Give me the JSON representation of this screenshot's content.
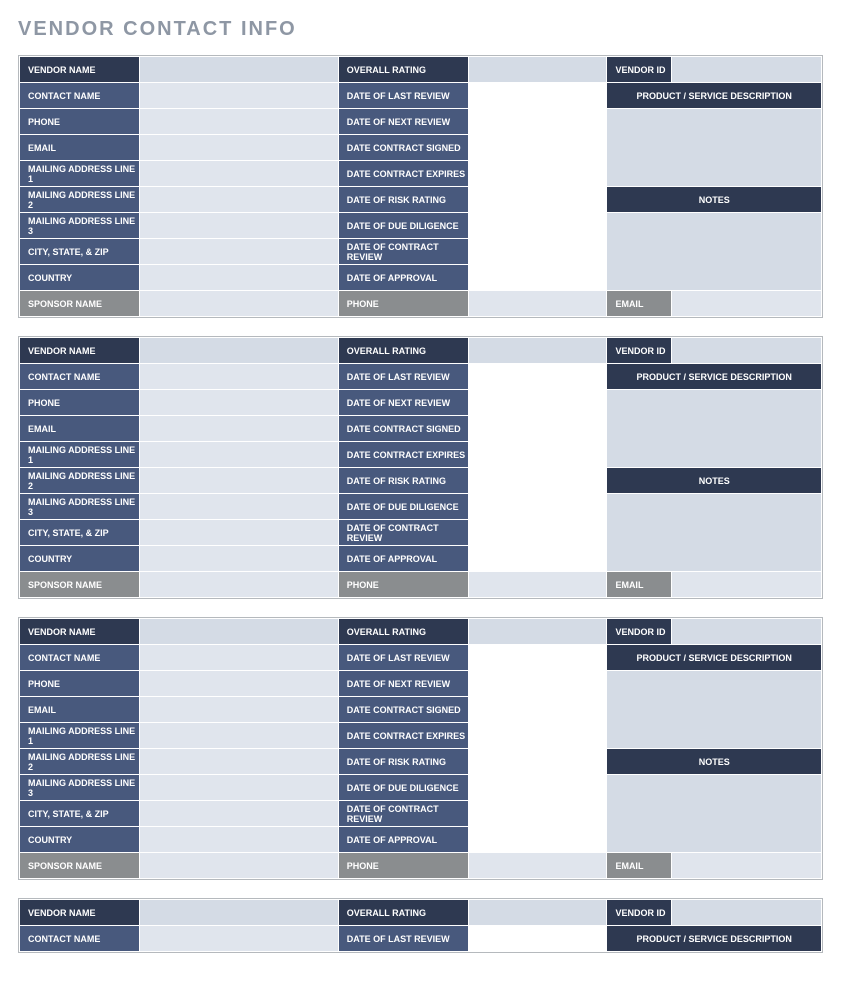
{
  "title": "VENDOR CONTACT INFO",
  "labels": {
    "vendor_name": "VENDOR NAME",
    "overall_rating": "OVERALL RATING",
    "vendor_id": "VENDOR ID",
    "contact_name": "CONTACT NAME",
    "date_last_review": "DATE OF LAST REVIEW",
    "product_service_desc": "PRODUCT / SERVICE DESCRIPTION",
    "phone": "PHONE",
    "date_next_review": "DATE OF NEXT REVIEW",
    "email": "EMAIL",
    "date_contract_signed": "DATE CONTRACT SIGNED",
    "mailing_1": "MAILING ADDRESS LINE 1",
    "date_contract_expires": "DATE CONTRACT EXPIRES",
    "mailing_2": "MAILING ADDRESS LINE 2",
    "date_risk_rating": "DATE OF RISK RATING",
    "notes": "NOTES",
    "mailing_3": "MAILING ADDRESS LINE 3",
    "date_due_diligence": "DATE OF DUE DILIGENCE",
    "city_state_zip": "CITY, STATE, & ZIP",
    "date_contract_review": "DATE OF CONTRACT REVIEW",
    "country": "COUNTRY",
    "date_approval": "DATE OF APPROVAL",
    "sponsor_name": "SPONSOR NAME",
    "sponsor_phone": "PHONE",
    "sponsor_email": "EMAIL"
  },
  "vendors": [
    {
      "vendor_name": "",
      "overall_rating": "",
      "vendor_id": "",
      "contact_name": "",
      "date_last_review": "",
      "phone": "",
      "date_next_review": "",
      "email": "",
      "date_contract_signed": "",
      "mailing_1": "",
      "date_contract_expires": "",
      "mailing_2": "",
      "date_risk_rating": "",
      "mailing_3": "",
      "date_due_diligence": "",
      "city_state_zip": "",
      "date_contract_review": "",
      "country": "",
      "date_approval": "",
      "product_service_desc": "",
      "notes": "",
      "sponsor_name": "",
      "sponsor_phone": "",
      "sponsor_email": ""
    },
    {
      "vendor_name": "",
      "overall_rating": "",
      "vendor_id": "",
      "contact_name": "",
      "date_last_review": "",
      "phone": "",
      "date_next_review": "",
      "email": "",
      "date_contract_signed": "",
      "mailing_1": "",
      "date_contract_expires": "",
      "mailing_2": "",
      "date_risk_rating": "",
      "mailing_3": "",
      "date_due_diligence": "",
      "city_state_zip": "",
      "date_contract_review": "",
      "country": "",
      "date_approval": "",
      "product_service_desc": "",
      "notes": "",
      "sponsor_name": "",
      "sponsor_phone": "",
      "sponsor_email": ""
    },
    {
      "vendor_name": "",
      "overall_rating": "",
      "vendor_id": "",
      "contact_name": "",
      "date_last_review": "",
      "phone": "",
      "date_next_review": "",
      "email": "",
      "date_contract_signed": "",
      "mailing_1": "",
      "date_contract_expires": "",
      "mailing_2": "",
      "date_risk_rating": "",
      "mailing_3": "",
      "date_due_diligence": "",
      "city_state_zip": "",
      "date_contract_review": "",
      "country": "",
      "date_approval": "",
      "product_service_desc": "",
      "notes": "",
      "sponsor_name": "",
      "sponsor_phone": "",
      "sponsor_email": ""
    },
    {
      "vendor_name": "",
      "overall_rating": "",
      "vendor_id": "",
      "contact_name": "",
      "date_last_review": "",
      "phone": "",
      "date_next_review": "",
      "email": "",
      "date_contract_signed": "",
      "mailing_1": "",
      "date_contract_expires": "",
      "mailing_2": "",
      "date_risk_rating": "",
      "mailing_3": "",
      "date_due_diligence": "",
      "city_state_zip": "",
      "date_contract_review": "",
      "country": "",
      "date_approval": "",
      "product_service_desc": "",
      "notes": "",
      "sponsor_name": "",
      "sponsor_phone": "",
      "sponsor_email": ""
    }
  ]
}
